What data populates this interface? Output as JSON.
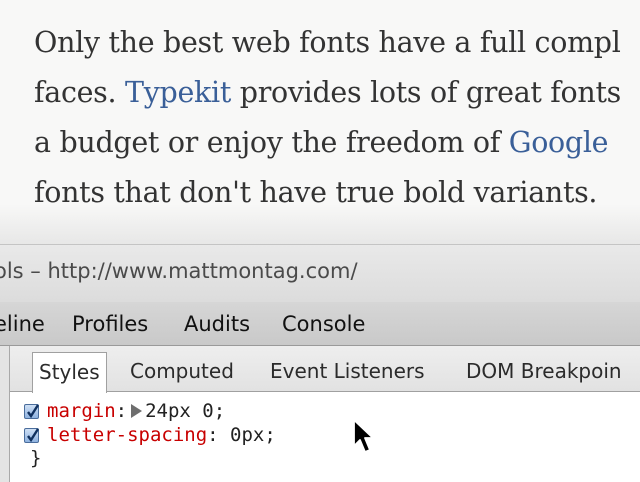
{
  "article": {
    "lines": [
      {
        "before": "Only the best web fonts have a full compl",
        "link": "",
        "after": ""
      },
      {
        "before": "faces. ",
        "link": "Typekit",
        "after": " provides lots of great fonts"
      },
      {
        "before": "a budget or enjoy the freedom of ",
        "link": "Google",
        "after": ""
      },
      {
        "before": "fonts that don't have true bold variants.",
        "link": "",
        "after": ""
      }
    ],
    "link_color": "#3a5f98"
  },
  "devtools": {
    "window_title": "ols – http://www.mattmontag.com/",
    "panel_tabs": [
      "eline",
      "Profiles",
      "Audits",
      "Console"
    ],
    "sub_tabs": [
      "Styles",
      "Computed",
      "Event Listeners",
      "DOM Breakpoin"
    ],
    "active_sub_tab": "Styles",
    "css_rules": [
      {
        "property": "margin",
        "separator": ":",
        "value": "24px 0;",
        "expandable": true,
        "checked": true
      },
      {
        "property": "letter-spacing",
        "separator": ":",
        "value": " 0px;",
        "expandable": false,
        "checked": true
      }
    ],
    "closing_brace": "}",
    "property_color": "#c80000"
  },
  "icons": {
    "checkbox": "checkmark-icon",
    "expand": "triangle-right-icon",
    "cursor": "mouse-pointer-icon"
  }
}
